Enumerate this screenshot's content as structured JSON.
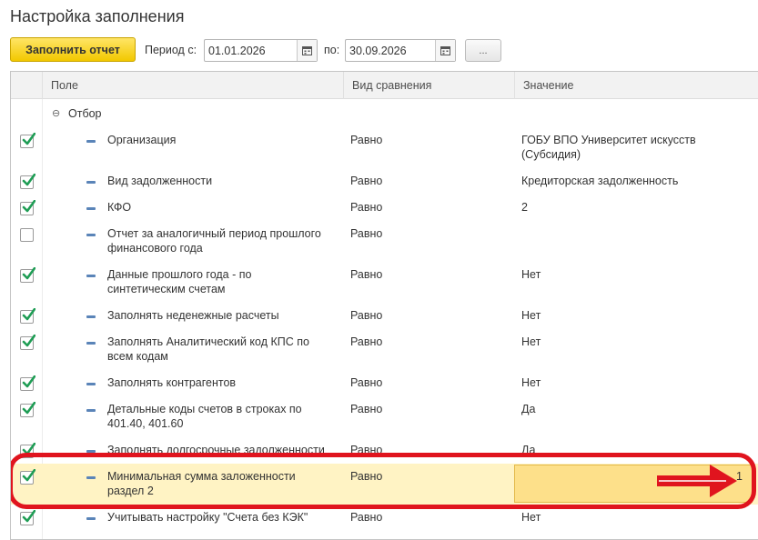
{
  "header": {
    "title": "Настройка заполнения",
    "fill_button": "Заполнить отчет",
    "period_from_label": "Период с:",
    "period_from_value": "01.01.2026",
    "period_to_label": "по:",
    "period_to_value": "30.09.2026",
    "more_button": "..."
  },
  "table": {
    "columns": [
      "Поле",
      "Вид сравнения",
      "Значение"
    ],
    "group_label": "Отбор",
    "rows": [
      {
        "checked": true,
        "field": "Организация",
        "field2": "",
        "compare": "Равно",
        "value": "ГОБУ ВПО Университет искусств",
        "value2": "(Субсидия)"
      },
      {
        "checked": true,
        "field": "Вид задолженности",
        "field2": "",
        "compare": "Равно",
        "value": "Кредиторская задолженность",
        "value2": ""
      },
      {
        "checked": true,
        "field": "КФО",
        "field2": "",
        "compare": "Равно",
        "value": "2",
        "value2": ""
      },
      {
        "checked": false,
        "field": "Отчет за аналогичный период прошлого",
        "field2": "финансового года",
        "compare": "Равно",
        "value": "",
        "value2": ""
      },
      {
        "checked": true,
        "field": "Данные прошлого года - по",
        "field2": "синтетическим счетам",
        "compare": "Равно",
        "value": "Нет",
        "value2": ""
      },
      {
        "checked": true,
        "field": "Заполнять неденежные расчеты",
        "field2": "",
        "compare": "Равно",
        "value": "Нет",
        "value2": ""
      },
      {
        "checked": true,
        "field": "Заполнять Аналитический код КПС по",
        "field2": "всем кодам",
        "compare": "Равно",
        "value": "Нет",
        "value2": ""
      },
      {
        "checked": true,
        "field": "Заполнять контрагентов",
        "field2": "",
        "compare": "Равно",
        "value": "Нет",
        "value2": ""
      },
      {
        "checked": true,
        "field": "Детальные коды счетов в строках по",
        "field2": "401.40, 401.60",
        "compare": "Равно",
        "value": "Да",
        "value2": ""
      },
      {
        "checked": true,
        "field": "Заполнять долгосрочные задолженности",
        "field2": "",
        "compare": "Равно",
        "value": "Да",
        "value2": ""
      },
      {
        "checked": true,
        "field": "Минимальная сумма заложенности",
        "field2": "раздел 2",
        "compare": "Равно",
        "value": "1",
        "value2": ""
      },
      {
        "checked": true,
        "field": "Учитывать настройку \"Счета без КЭК\"",
        "field2": "",
        "compare": "Равно",
        "value": "Нет",
        "value2": ""
      }
    ]
  },
  "colors": {
    "accent_yellow": "#f2c800",
    "highlight": "#fff3c4",
    "annotation_red": "#e0141e",
    "check_green": "#1f9d55"
  }
}
